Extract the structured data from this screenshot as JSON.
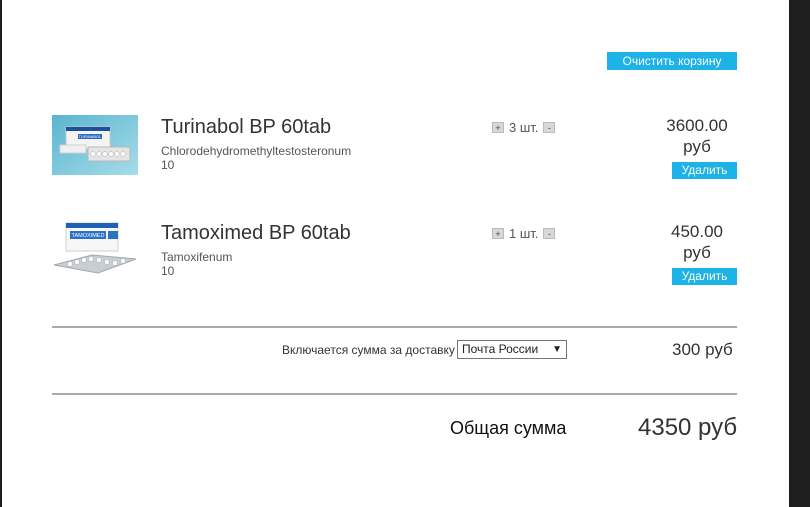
{
  "cart": {
    "clear_label": "Очистить корзину",
    "items": [
      {
        "name": "Turinabol BP 60tab",
        "ingredient": "Chlorodehydromethyltestosteronum",
        "dose": "10",
        "qty_plus": "+",
        "qty_text": "3 шт.",
        "qty_minus": "-",
        "price": "3600.00",
        "currency": "руб",
        "delete_label": "Удалить",
        "box_label": "TURINABOL"
      },
      {
        "name": "Tamoximed BP 60tab",
        "ingredient": "Tamoxifenum",
        "dose": "10",
        "qty_plus": "+",
        "qty_text": "1 шт.",
        "qty_minus": "-",
        "price": "450.00",
        "currency": "руб",
        "delete_label": "Удалить",
        "box_label": "TAMOXIMED"
      }
    ],
    "shipping": {
      "label": "Включается сумма за доставку",
      "method": "Почта России",
      "cost": "300 руб"
    },
    "total": {
      "label": "Общая сумма",
      "value": "4350 руб"
    }
  },
  "colors": {
    "accent": "#1eb3e6",
    "background": "#ffffff",
    "frame": "#1e1e1e",
    "divider": "#aaaaaa"
  }
}
